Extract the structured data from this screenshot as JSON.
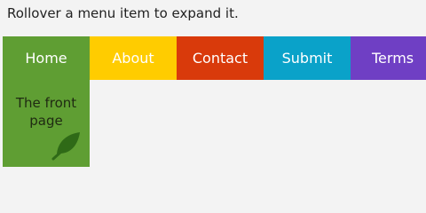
{
  "instructions": "Rollover a menu item to expand it.",
  "menu": {
    "items": [
      {
        "label": "Home"
      },
      {
        "label": "About"
      },
      {
        "label": "Contact"
      },
      {
        "label": "Submit"
      },
      {
        "label": "Terms"
      }
    ]
  },
  "submenu": {
    "line1": "The front",
    "line2": "page",
    "icon": "leaf-icon"
  },
  "colors": {
    "background": "#f3f3f3",
    "home": "#5f9e33",
    "about": "#ffcc00",
    "contact": "#d93a0b",
    "submit": "#0aa2c9",
    "terms": "#6f3fc4",
    "leaf": "#2f6a17"
  }
}
